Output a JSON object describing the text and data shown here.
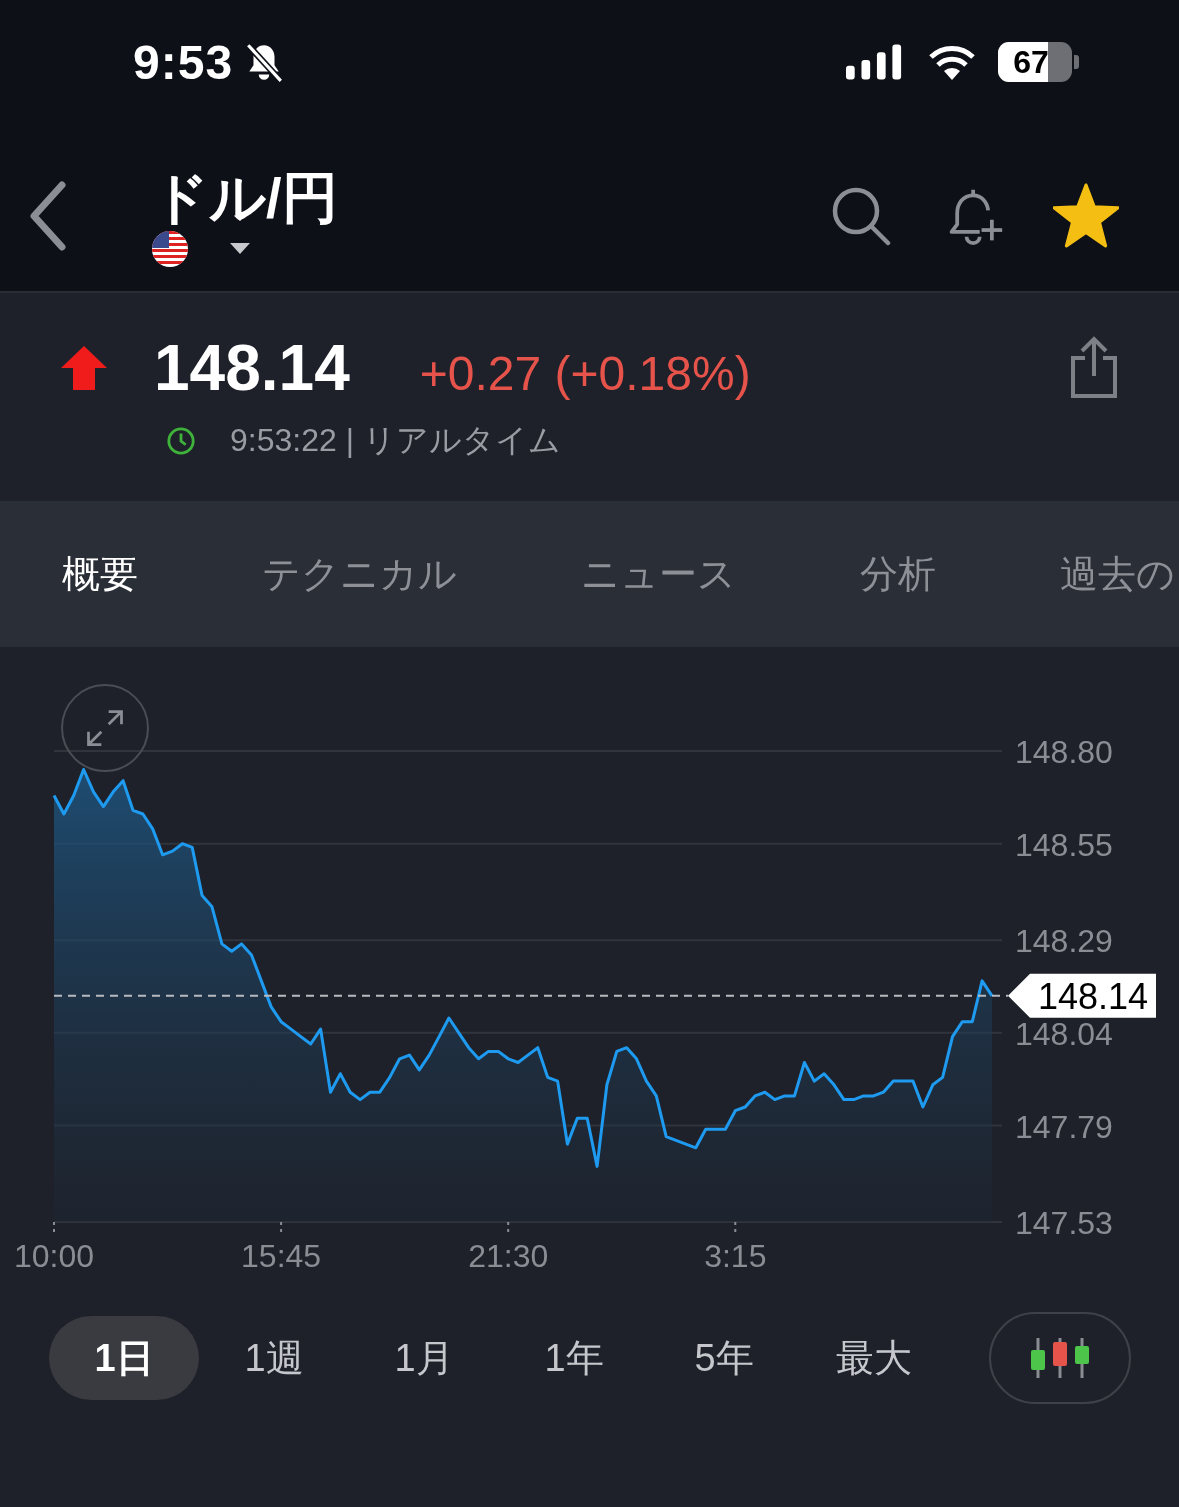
{
  "status_bar": {
    "time": "9:53",
    "silent": true,
    "battery": "67"
  },
  "header": {
    "title": "ドル/円",
    "favorite": true
  },
  "quote": {
    "rising": true,
    "price": "148.14",
    "change": "+0.27 (+0.18%)",
    "timestamp": "9:53:22 | リアルタイム"
  },
  "tabs": [
    {
      "label": "概要",
      "selected": true
    },
    {
      "label": "テクニカル",
      "selected": false
    },
    {
      "label": "ニュース",
      "selected": false
    },
    {
      "label": "分析",
      "selected": false
    },
    {
      "label": "過去の",
      "selected": false
    }
  ],
  "chart": {
    "chart_data": {
      "type": "area",
      "grid": true,
      "categories": [
        "10:00",
        null,
        null,
        null,
        null,
        null,
        null,
        null,
        null,
        null,
        null,
        null,
        null,
        null,
        null,
        null,
        null,
        null,
        null,
        null,
        null,
        null,
        null,
        "15:45",
        null,
        null,
        null,
        null,
        null,
        null,
        null,
        null,
        null,
        null,
        null,
        null,
        null,
        null,
        null,
        null,
        null,
        null,
        null,
        null,
        null,
        null,
        "21:30",
        null,
        null,
        null,
        null,
        null,
        null,
        null,
        null,
        null,
        null,
        null,
        null,
        null,
        null,
        null,
        null,
        null,
        null,
        null,
        null,
        null,
        null,
        "3:15",
        null,
        null,
        null,
        null,
        null,
        null,
        null,
        null,
        null,
        null,
        null,
        null,
        null,
        null,
        null,
        null,
        null,
        null,
        null,
        null,
        null,
        null,
        null,
        null,
        null,
        null
      ],
      "series": [
        {
          "color": "#1e9bf0",
          "values": [
            148.68,
            148.63,
            148.68,
            148.75,
            148.69,
            148.65,
            148.69,
            148.72,
            148.64,
            148.63,
            148.59,
            148.52,
            148.53,
            148.55,
            148.54,
            148.41,
            148.38,
            148.28,
            148.26,
            148.28,
            148.25,
            148.18,
            148.11,
            148.07,
            148.05,
            148.03,
            148.01,
            148.05,
            147.88,
            147.93,
            147.88,
            147.86,
            147.88,
            147.88,
            147.92,
            147.97,
            147.98,
            147.94,
            147.98,
            148.03,
            148.08,
            148.04,
            148.0,
            147.97,
            147.99,
            147.99,
            147.97,
            147.96,
            147.98,
            148.0,
            147.92,
            147.91,
            147.74,
            147.81,
            147.81,
            147.68,
            147.9,
            147.99,
            148.0,
            147.97,
            147.91,
            147.87,
            147.76,
            147.75,
            147.74,
            147.73,
            147.78,
            147.78,
            147.78,
            147.83,
            147.84,
            147.87,
            147.88,
            147.86,
            147.87,
            147.87,
            147.96,
            147.91,
            147.93,
            147.9,
            147.86,
            147.86,
            147.87,
            147.87,
            147.88,
            147.91,
            147.91,
            147.91,
            147.84,
            147.9,
            147.92,
            148.03,
            148.07,
            148.07,
            148.18,
            148.14
          ]
        }
      ],
      "ylim": [
        147.53,
        148.8
      ],
      "yticks": [
        {
          "value": 148.8,
          "label": "148.80"
        },
        {
          "value": 148.55,
          "label": "148.55"
        },
        {
          "value": 148.29,
          "label": "148.29"
        },
        {
          "value": 148.04,
          "label": "148.04"
        },
        {
          "value": 147.79,
          "label": "147.79"
        },
        {
          "value": 147.53,
          "label": "147.53"
        }
      ],
      "ref_lines": [
        {
          "axis": "y",
          "value": 148.14,
          "label": "148.14"
        }
      ]
    }
  },
  "ranges": [
    {
      "label": "1日",
      "selected": true
    },
    {
      "label": "1週",
      "selected": false
    },
    {
      "label": "1月",
      "selected": false
    },
    {
      "label": "1年",
      "selected": false
    },
    {
      "label": "5年",
      "selected": false
    },
    {
      "label": "最大",
      "selected": false
    }
  ]
}
